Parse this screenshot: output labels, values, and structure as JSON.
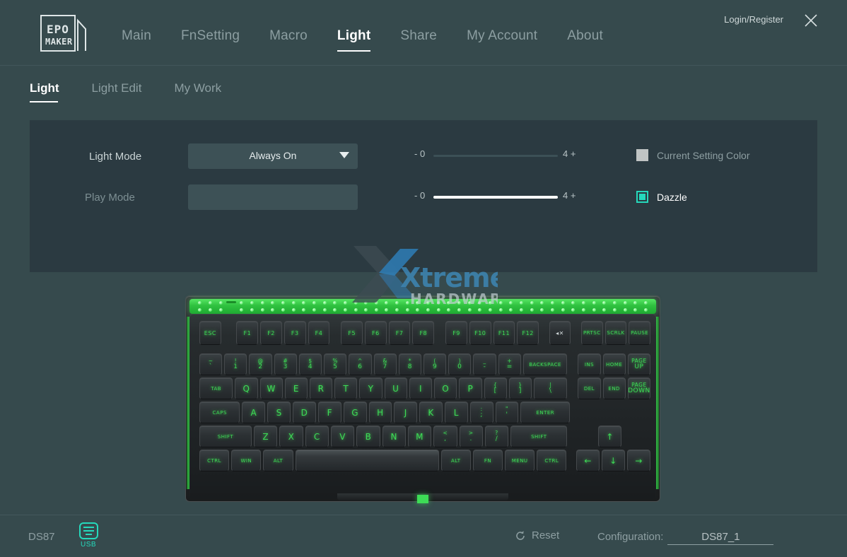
{
  "header": {
    "logo_line1": "EPO",
    "logo_line2": "MAKER",
    "logo_alt": "epomaker-logo",
    "login_register": "Login/Register",
    "close_icon": "close-icon",
    "nav": [
      {
        "label": "Main",
        "active": false
      },
      {
        "label": "FnSetting",
        "active": false
      },
      {
        "label": "Macro",
        "active": false
      },
      {
        "label": "Light",
        "active": true
      },
      {
        "label": "Share",
        "active": false
      },
      {
        "label": "My Account",
        "active": false
      },
      {
        "label": "About",
        "active": false
      }
    ]
  },
  "subnav": [
    {
      "label": "Light",
      "active": true
    },
    {
      "label": "Light Edit",
      "active": false
    },
    {
      "label": "My Work",
      "active": false
    }
  ],
  "panel": {
    "light_mode_label": "Light Mode",
    "play_mode_label": "Play Mode",
    "light_mode_value": "Always On",
    "play_mode_value": "",
    "caret_icon": "chevron-down-icon",
    "sliders": [
      {
        "name": "brightness",
        "minus": "- 0",
        "plus": "4 +",
        "min": 0,
        "max": 4,
        "value": 0,
        "fill_percent": 0,
        "track_color": "#3c5056",
        "fill_color": "#ffffff"
      },
      {
        "name": "speed",
        "minus": "- 0",
        "plus": "4 +",
        "min": 0,
        "max": 4,
        "value": 4,
        "fill_percent": 100,
        "track_color": "#3c5056",
        "fill_color": "#ffffff"
      }
    ],
    "checkboxes": [
      {
        "label": "Current Setting Color",
        "checked": false,
        "color": "#c0c4c4"
      },
      {
        "label": "Dazzle",
        "checked": true,
        "color": "#25d9bc"
      }
    ]
  },
  "watermark": {
    "word1": "Xtreme",
    "word2": "HARDWARE",
    "accent": "#2f87c9"
  },
  "keyboard": {
    "name": "keyboard-preview",
    "led_color": "#3ddc56",
    "legend_color": "#3ddc56",
    "rows": [
      {
        "name": "function-row",
        "keys": [
          {
            "label": "ESC",
            "w": 1.0
          },
          {
            "label": "",
            "w": 0.55,
            "type": "gap"
          },
          {
            "label": "F1",
            "w": 1.0
          },
          {
            "label": "F2",
            "w": 1.0
          },
          {
            "label": "F3",
            "w": 1.0
          },
          {
            "label": "F4",
            "w": 1.0
          },
          {
            "label": "",
            "w": 0.35,
            "type": "gap"
          },
          {
            "label": "F5",
            "w": 1.0
          },
          {
            "label": "F6",
            "w": 1.0
          },
          {
            "label": "F7",
            "w": 1.0
          },
          {
            "label": "F8",
            "w": 1.0
          },
          {
            "label": "",
            "w": 0.35,
            "type": "gap"
          },
          {
            "label": "F9",
            "w": 1.0
          },
          {
            "label": "F10",
            "w": 1.0
          },
          {
            "label": "F11",
            "w": 1.0
          },
          {
            "label": "F12",
            "w": 1.0
          },
          {
            "label": "",
            "w": 0.3,
            "type": "gap"
          },
          {
            "label": "◂✕",
            "w": 1.0,
            "type": "dim"
          },
          {
            "label": "",
            "w": 0.3,
            "type": "gap"
          },
          {
            "label": "PRTSC",
            "w": 1.0,
            "type": "big"
          },
          {
            "label": "SCRLK",
            "w": 1.0,
            "type": "big"
          },
          {
            "label": "PAUSE",
            "w": 1.0,
            "type": "big"
          }
        ]
      },
      {
        "name": "number-row",
        "keys": [
          {
            "top": "~",
            "bot": "`",
            "w": 1.0
          },
          {
            "top": "!",
            "bot": "1",
            "w": 1.0
          },
          {
            "top": "@",
            "bot": "2",
            "w": 1.0
          },
          {
            "top": "#",
            "bot": "3",
            "w": 1.0
          },
          {
            "top": "$",
            "bot": "4",
            "w": 1.0
          },
          {
            "top": "%",
            "bot": "5",
            "w": 1.0
          },
          {
            "top": "^",
            "bot": "6",
            "w": 1.0
          },
          {
            "top": "&",
            "bot": "7",
            "w": 1.0
          },
          {
            "top": "*",
            "bot": "8",
            "w": 1.0
          },
          {
            "top": "(",
            "bot": "9",
            "w": 1.0
          },
          {
            "top": ")",
            "bot": "0",
            "w": 1.0
          },
          {
            "top": "_",
            "bot": "-",
            "w": 1.0
          },
          {
            "top": "+",
            "bot": "=",
            "w": 1.0
          },
          {
            "label": "BACKSPACE",
            "w": 2.0,
            "type": "big"
          },
          {
            "label": "",
            "w": 0.3,
            "type": "gap"
          },
          {
            "label": "INS",
            "w": 1.0,
            "type": "big"
          },
          {
            "label": "HOME",
            "w": 1.0,
            "type": "big"
          },
          {
            "top": "PAGE",
            "bot": "UP",
            "w": 1.0,
            "type": "big"
          }
        ]
      },
      {
        "name": "qwerty-row",
        "keys": [
          {
            "label": "TAB",
            "w": 1.5,
            "type": "big"
          },
          {
            "label": "Q",
            "w": 1.0,
            "type": "letter"
          },
          {
            "label": "W",
            "w": 1.0,
            "type": "letter"
          },
          {
            "label": "E",
            "w": 1.0,
            "type": "letter"
          },
          {
            "label": "R",
            "w": 1.0,
            "type": "letter"
          },
          {
            "label": "T",
            "w": 1.0,
            "type": "letter"
          },
          {
            "label": "Y",
            "w": 1.0,
            "type": "letter"
          },
          {
            "label": "U",
            "w": 1.0,
            "type": "letter"
          },
          {
            "label": "I",
            "w": 1.0,
            "type": "letter"
          },
          {
            "label": "O",
            "w": 1.0,
            "type": "letter"
          },
          {
            "label": "P",
            "w": 1.0,
            "type": "letter"
          },
          {
            "top": "{",
            "bot": "[",
            "w": 1.0
          },
          {
            "top": "}",
            "bot": "]",
            "w": 1.0
          },
          {
            "top": "|",
            "bot": "\\",
            "w": 1.5
          },
          {
            "label": "",
            "w": 0.3,
            "type": "gap"
          },
          {
            "label": "DEL",
            "w": 1.0,
            "type": "big"
          },
          {
            "label": "END",
            "w": 1.0,
            "type": "big"
          },
          {
            "top": "PAGE",
            "bot": "DOWN",
            "w": 1.0,
            "type": "big"
          }
        ]
      },
      {
        "name": "home-row",
        "keys": [
          {
            "label": "CAPS",
            "w": 1.8,
            "type": "big"
          },
          {
            "label": "A",
            "w": 1.0,
            "type": "letter"
          },
          {
            "label": "S",
            "w": 1.0,
            "type": "letter"
          },
          {
            "label": "D",
            "w": 1.0,
            "type": "letter"
          },
          {
            "label": "F",
            "w": 1.0,
            "type": "letter"
          },
          {
            "label": "G",
            "w": 1.0,
            "type": "letter"
          },
          {
            "label": "H",
            "w": 1.0,
            "type": "letter"
          },
          {
            "label": "J",
            "w": 1.0,
            "type": "letter"
          },
          {
            "label": "K",
            "w": 1.0,
            "type": "letter"
          },
          {
            "label": "L",
            "w": 1.0,
            "type": "letter"
          },
          {
            "top": ":",
            "bot": ";",
            "w": 1.0
          },
          {
            "top": "\"",
            "bot": "'",
            "w": 1.0
          },
          {
            "label": "ENTER",
            "w": 2.2,
            "type": "big"
          },
          {
            "label": "",
            "w": 3.6,
            "type": "gap"
          }
        ]
      },
      {
        "name": "shift-row",
        "keys": [
          {
            "label": "SHIFT",
            "w": 2.3,
            "type": "big"
          },
          {
            "label": "Z",
            "w": 1.0,
            "type": "letter"
          },
          {
            "label": "X",
            "w": 1.0,
            "type": "letter"
          },
          {
            "label": "C",
            "w": 1.0,
            "type": "letter"
          },
          {
            "label": "V",
            "w": 1.0,
            "type": "letter"
          },
          {
            "label": "B",
            "w": 1.0,
            "type": "letter"
          },
          {
            "label": "N",
            "w": 1.0,
            "type": "letter"
          },
          {
            "label": "M",
            "w": 1.0,
            "type": "letter"
          },
          {
            "top": "<",
            "bot": ",",
            "w": 1.0
          },
          {
            "top": ">",
            "bot": ".",
            "w": 1.0
          },
          {
            "top": "?",
            "bot": "/",
            "w": 1.0
          },
          {
            "label": "SHIFT",
            "w": 2.5,
            "type": "big"
          },
          {
            "label": "",
            "w": 1.2,
            "type": "gap"
          },
          {
            "label": "↑",
            "w": 1.0,
            "type": "letter"
          },
          {
            "label": "",
            "w": 1.2,
            "type": "gap"
          }
        ]
      },
      {
        "name": "modifier-row",
        "keys": [
          {
            "label": "CTRL",
            "w": 1.3,
            "type": "big"
          },
          {
            "label": "WIN",
            "w": 1.3,
            "type": "big"
          },
          {
            "label": "ALT",
            "w": 1.3,
            "type": "big"
          },
          {
            "label": "",
            "w": 6.5,
            "type": "space"
          },
          {
            "label": "ALT",
            "w": 1.3,
            "type": "big"
          },
          {
            "label": "FN",
            "w": 1.3,
            "type": "big"
          },
          {
            "label": "MENU",
            "w": 1.3,
            "type": "big"
          },
          {
            "label": "CTRL",
            "w": 1.3,
            "type": "big"
          },
          {
            "label": "",
            "w": 0.25,
            "type": "gap"
          },
          {
            "label": "←",
            "w": 1.0,
            "type": "letter"
          },
          {
            "label": "↓",
            "w": 1.0,
            "type": "letter"
          },
          {
            "label": "→",
            "w": 1.0,
            "type": "letter"
          }
        ]
      }
    ]
  },
  "footer": {
    "device_name": "DS87",
    "connection_icon": "keyboard-icon",
    "connection_label": "USB",
    "reset_icon": "refresh-icon",
    "reset_label": "Reset",
    "configuration_label": "Configuration:",
    "configuration_value": "DS87_1"
  }
}
